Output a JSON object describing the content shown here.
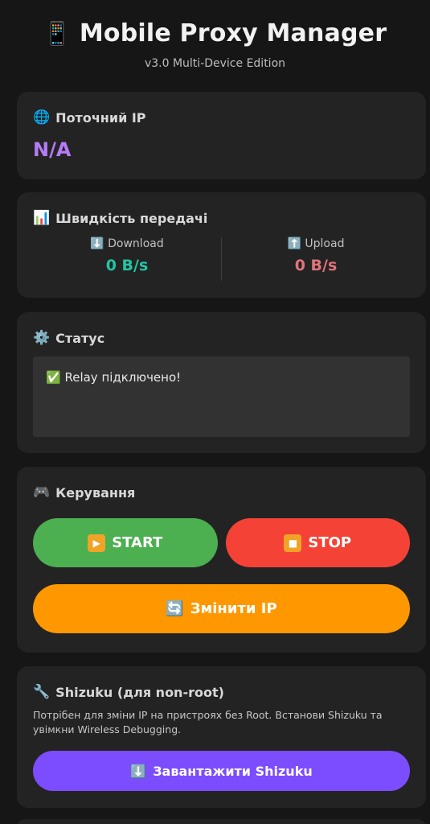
{
  "header": {
    "title_icon": "📱",
    "title": "Mobile Proxy Manager",
    "subtitle": "v3.0 Multi-Device Edition"
  },
  "ip_card": {
    "icon": "🌐",
    "title": "Поточний IP",
    "value": "N/A"
  },
  "speed_card": {
    "icon": "📊",
    "title": "Швидкість передачі",
    "download": {
      "icon": "⬇️",
      "label": "Download",
      "value": "0 B/s"
    },
    "upload": {
      "icon": "⬆️",
      "label": "Upload",
      "value": "0 B/s"
    }
  },
  "status_card": {
    "icon": "⚙️",
    "title": "Статус",
    "message_icon": "✅",
    "message": "Relay підключено!"
  },
  "control_card": {
    "icon": "🎮",
    "title": "Керування",
    "start": {
      "icon": "▶",
      "label": "START"
    },
    "stop": {
      "icon": "■",
      "label": "STOP"
    },
    "change_ip": {
      "icon": "🔄",
      "label": "Змінити IP"
    }
  },
  "shizuku_card": {
    "icon": "🔧",
    "title": "Shizuku (для non-root)",
    "description": "Потрібен для зміни IP на пристроях без Root. Встанови Shizuku та увімкни Wireless Debugging.",
    "download": {
      "icon": "⬇️",
      "label": "Завантажити Shizuku"
    }
  },
  "colors": {
    "background": "#161616",
    "card": "#232323",
    "ip_value": "#b67cf7",
    "download": "#23c5a3",
    "upload": "#e2737a",
    "start": "#4caf50",
    "stop": "#f44336",
    "change_ip": "#ff9800",
    "shizuku": "#7c4dff"
  }
}
